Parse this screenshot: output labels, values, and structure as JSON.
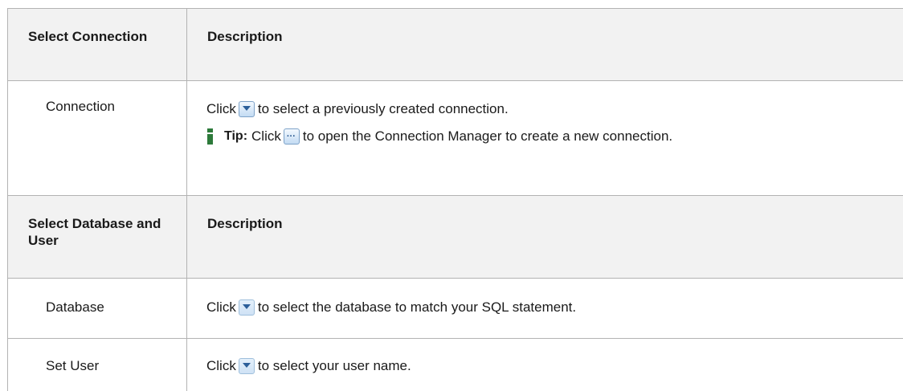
{
  "section1": {
    "header_col1": "Select Connection",
    "header_col2": "Description",
    "rows": [
      {
        "name": "Connection",
        "desc_before": "Click",
        "desc_after": "to select a previously created connection.",
        "icon": "dropdown-arrow-icon",
        "tip": {
          "label": "Tip:",
          "before": "Click",
          "after": "to open the Connection Manager to create a new connection.",
          "icon": "ellipsis-button-icon"
        }
      }
    ]
  },
  "section2": {
    "header_col1": "Select Database and User",
    "header_col2": "Description",
    "rows": [
      {
        "name": "Database",
        "desc_before": "Click",
        "desc_after": "to select the database to match your SQL statement.",
        "icon": "dropdown-arrow-icon"
      },
      {
        "name": "Set User",
        "desc_before": "Click",
        "desc_after": "to select your user name.",
        "icon": "dropdown-arrow-icon"
      }
    ]
  },
  "colors": {
    "header_bg": "#f2f2f2",
    "border": "#b3b3b3",
    "info_icon": "#2d7a3a",
    "button_blue": "#7da2c8"
  }
}
